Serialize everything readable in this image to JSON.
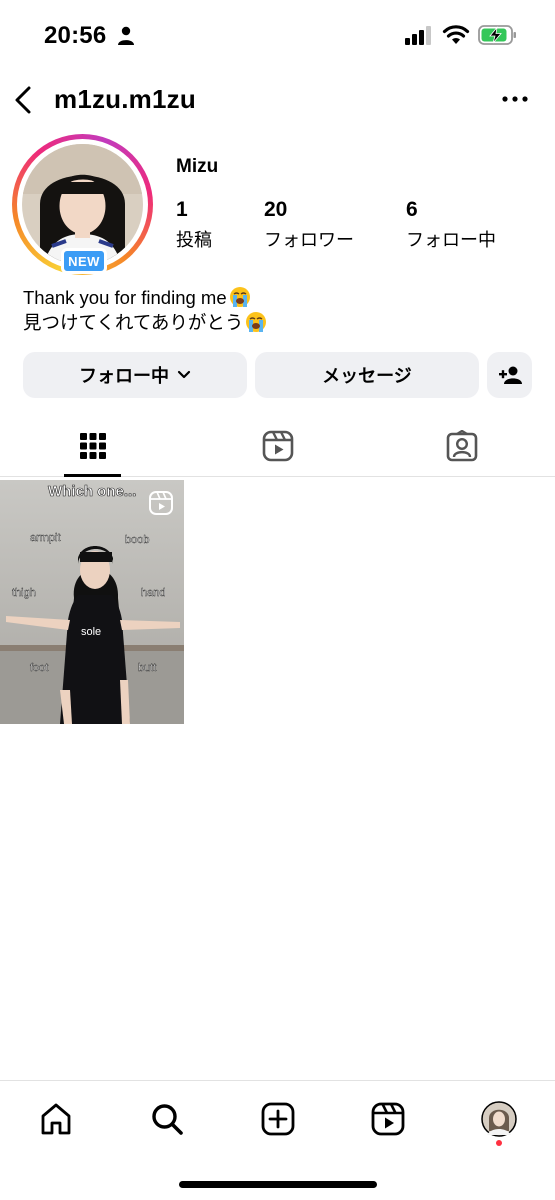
{
  "status_bar": {
    "time": "20:56"
  },
  "header": {
    "username": "m1zu.m1zu"
  },
  "profile": {
    "display_name": "Mizu",
    "badge": "NEW",
    "stats": [
      {
        "value": "1",
        "label": "投稿"
      },
      {
        "value": "20",
        "label": "フォロワー"
      },
      {
        "value": "6",
        "label": "フォロー中"
      }
    ],
    "bio": {
      "line1": "Thank you for finding me",
      "line2": "見つけてくれてありがとう",
      "emoji": "loudly-crying-face-emoji"
    }
  },
  "actions": {
    "following_label": "フォロー中",
    "message_label": "メッセージ"
  },
  "tabs": [
    {
      "icon": "grid-icon",
      "selected": true
    },
    {
      "icon": "reels-icon",
      "selected": false
    },
    {
      "icon": "tagged-icon",
      "selected": false
    }
  ],
  "posts": [
    {
      "type": "reel",
      "caption": "Which one...",
      "labels": [
        "armpit",
        "boob",
        "thigh",
        "hand",
        "sole",
        "foot",
        "butt"
      ]
    }
  ],
  "bottom_nav": [
    "home-icon",
    "search-icon",
    "create-icon",
    "reels-icon",
    "profile-avatar"
  ],
  "colors": {
    "badge_blue": "#3b9cf5",
    "button_gray": "#eff0f3",
    "notification_red": "#ff3040"
  }
}
